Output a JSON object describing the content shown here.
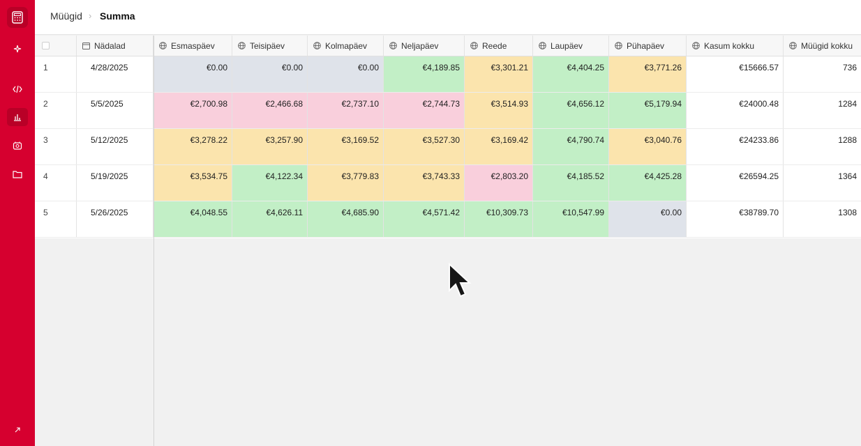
{
  "breadcrumb": {
    "parent": "Müügid",
    "separator": "›",
    "current": "Summa"
  },
  "sidebar": {
    "accent": "#d6002f",
    "icons": [
      "calculator-icon",
      "sparkle-icon",
      "code-icon",
      "bar-chart-icon",
      "gauge-icon",
      "folder-icon",
      "share-icon"
    ]
  },
  "table": {
    "columns": {
      "weeks": "Nädalad",
      "mon": "Esmaspäev",
      "tue": "Teisipäev",
      "wed": "Kolmapäev",
      "thu": "Neljapäev",
      "fri": "Reede",
      "sat": "Laupäev",
      "sun": "Pühapäev",
      "profit": "Kasum kokku",
      "sales": "Müügid kokku"
    },
    "rows": [
      {
        "idx": "1",
        "week": "4/28/2025",
        "mon": "€0.00",
        "tue": "€0.00",
        "wed": "€0.00",
        "thu": "€4,189.85",
        "fri": "€3,301.21",
        "sat": "€4,404.25",
        "sun": "€3,771.26",
        "profit": "€15666.57",
        "sales": "736"
      },
      {
        "idx": "2",
        "week": "5/5/2025",
        "mon": "€2,700.98",
        "tue": "€2,466.68",
        "wed": "€2,737.10",
        "thu": "€2,744.73",
        "fri": "€3,514.93",
        "sat": "€4,656.12",
        "sun": "€5,179.94",
        "profit": "€24000.48",
        "sales": "1284"
      },
      {
        "idx": "3",
        "week": "5/12/2025",
        "mon": "€3,278.22",
        "tue": "€3,257.90",
        "wed": "€3,169.52",
        "thu": "€3,527.30",
        "fri": "€3,169.42",
        "sat": "€4,790.74",
        "sun": "€3,040.76",
        "profit": "€24233.86",
        "sales": "1288"
      },
      {
        "idx": "4",
        "week": "5/19/2025",
        "mon": "€3,534.75",
        "tue": "€4,122.34",
        "wed": "€3,779.83",
        "thu": "€3,743.33",
        "fri": "€2,803.20",
        "sat": "€4,185.52",
        "sun": "€4,425.28",
        "profit": "€26594.25",
        "sales": "1364"
      },
      {
        "idx": "5",
        "week": "5/26/2025",
        "mon": "€4,048.55",
        "tue": "€4,626.11",
        "wed": "€4,685.90",
        "thu": "€4,571.42",
        "fri": "€10,309.73",
        "sat": "€10,547.99",
        "sun": "€0.00",
        "profit": "€38789.70",
        "sales": "1308"
      }
    ],
    "cell_colors": {
      "gray": "#dfe3ea",
      "green": "#c2efc6",
      "yellow": "#fbe4ad",
      "pink": "#f9cfdc"
    }
  }
}
